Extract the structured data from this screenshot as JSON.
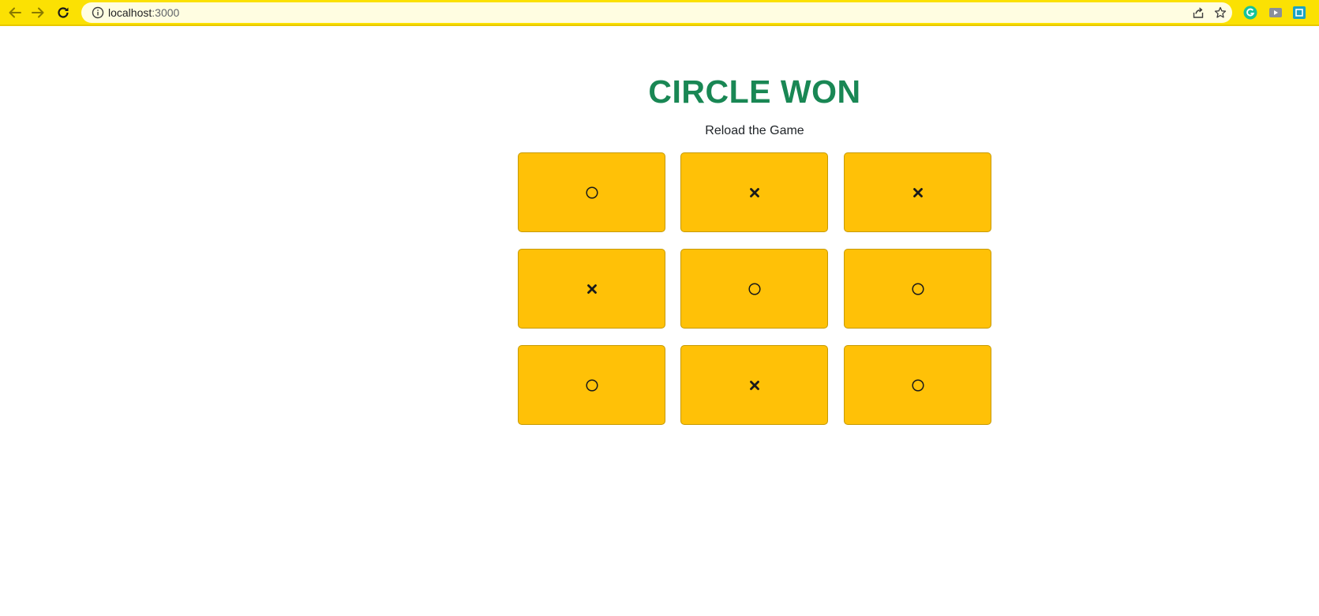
{
  "browser": {
    "url_host": "localhost",
    "url_port": ":3000",
    "toolbar_color": "#fbe103",
    "omnibox_color": "#fffde1"
  },
  "game": {
    "title": "CIRCLE WON",
    "title_color": "#198754",
    "subtitle": "Reload the Game",
    "cell_color": "#ffc107",
    "board": [
      "circle",
      "cross",
      "cross",
      "cross",
      "circle",
      "circle",
      "circle",
      "cross",
      "circle"
    ]
  }
}
